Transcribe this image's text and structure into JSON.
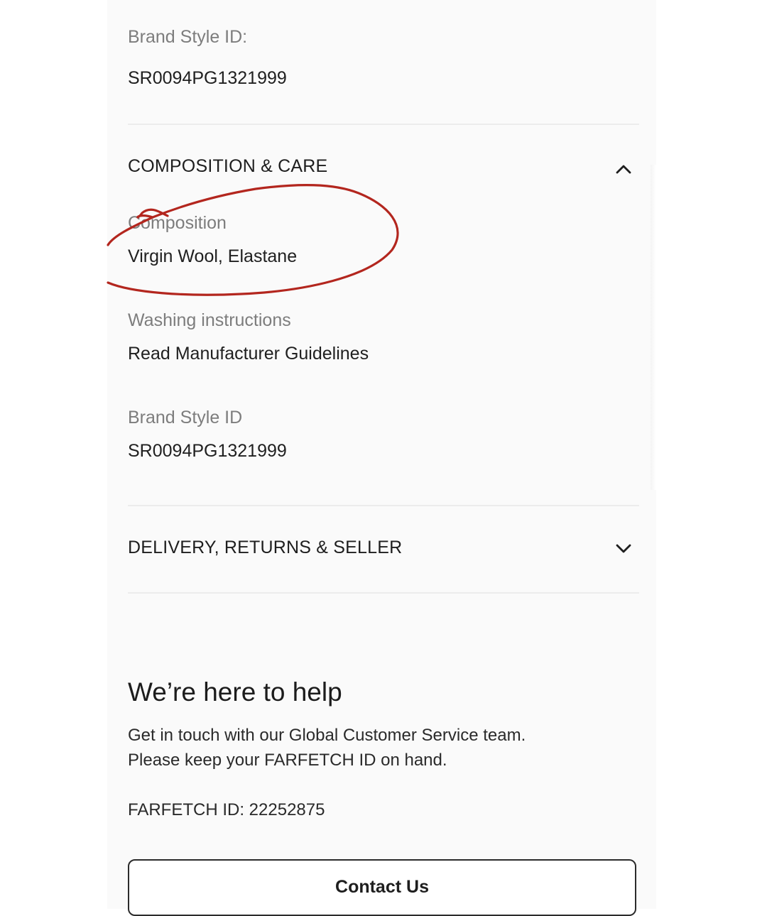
{
  "details": {
    "brand_style_label": "Brand Style ID:",
    "brand_style_value": "SR0094PG1321999"
  },
  "composition_care": {
    "title": "COMPOSITION & CARE",
    "expanded": true,
    "composition_label": "Composition",
    "composition_value": "Virgin Wool, Elastane",
    "washing_label": "Washing instructions",
    "washing_value": "Read Manufacturer Guidelines",
    "brand_style_label": "Brand Style ID",
    "brand_style_value": "SR0094PG1321999",
    "icon": "chevron-up-icon"
  },
  "delivery": {
    "title": "DELIVERY, RETURNS & SELLER",
    "expanded": false,
    "icon": "chevron-down-icon"
  },
  "help": {
    "title": "We’re here to help",
    "line1": "Get in touch with our Global Customer Service team.",
    "line2": "Please keep your FARFETCH ID on hand.",
    "farfetch_id": "FARFETCH ID: 22252875",
    "contact_label": "Contact Us"
  },
  "annotation": {
    "type": "hand-drawn circle",
    "color": "#b3261e",
    "circles": "composition"
  }
}
